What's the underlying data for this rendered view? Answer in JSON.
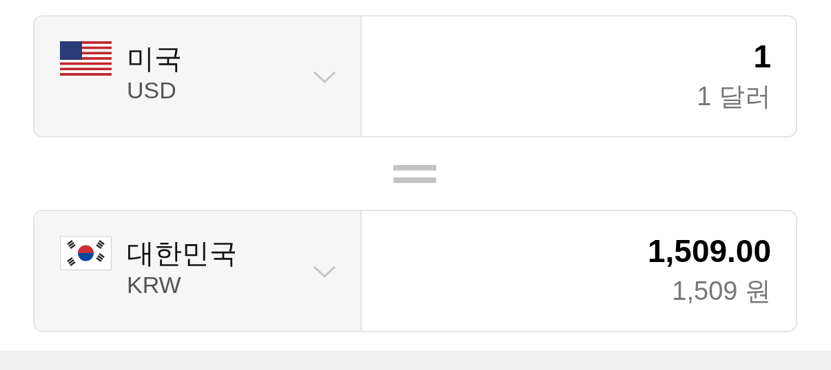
{
  "converters": [
    {
      "kind": "us",
      "country": "미국",
      "code": "USD",
      "amount": "1",
      "amount_words": "1 달러"
    },
    {
      "kind": "kr",
      "country": "대한민국",
      "code": "KRW",
      "amount": "1,509.00",
      "amount_words": "1,509 원"
    }
  ]
}
